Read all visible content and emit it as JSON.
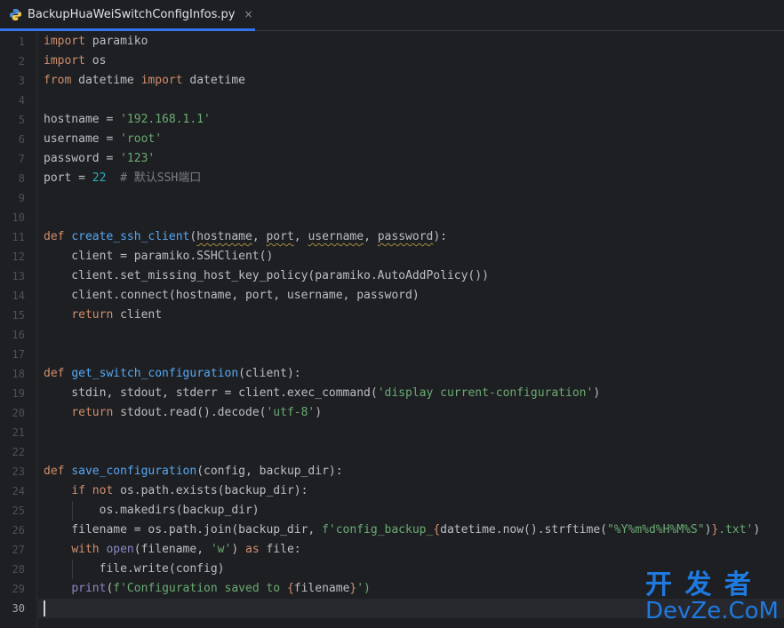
{
  "tab": {
    "filename": "BackupHuaWeiSwitchConfigInfos.py",
    "close": "×",
    "icon": "python-icon"
  },
  "editor": {
    "current_line": 30,
    "line_numbers": [
      "1",
      "2",
      "3",
      "4",
      "5",
      "6",
      "7",
      "8",
      "9",
      "10",
      "11",
      "12",
      "13",
      "14",
      "15",
      "16",
      "17",
      "18",
      "19",
      "20",
      "21",
      "22",
      "23",
      "24",
      "25",
      "26",
      "27",
      "28",
      "29",
      "30"
    ],
    "lines": [
      [
        {
          "t": "import",
          "c": "kw"
        },
        {
          "t": " paramiko"
        }
      ],
      [
        {
          "t": "import",
          "c": "kw"
        },
        {
          "t": " os"
        }
      ],
      [
        {
          "t": "from",
          "c": "kw"
        },
        {
          "t": " datetime "
        },
        {
          "t": "import",
          "c": "kw"
        },
        {
          "t": " datetime"
        }
      ],
      [],
      [
        {
          "t": "hostname = "
        },
        {
          "t": "'192.168.1.1'",
          "c": "str"
        }
      ],
      [
        {
          "t": "username = "
        },
        {
          "t": "'root'",
          "c": "str"
        }
      ],
      [
        {
          "t": "password = "
        },
        {
          "t": "'123'",
          "c": "str"
        }
      ],
      [
        {
          "t": "port = "
        },
        {
          "t": "22",
          "c": "num"
        },
        {
          "t": "  # 默认SSH端口",
          "c": "cmt"
        }
      ],
      [],
      [],
      [
        {
          "t": "def",
          "c": "kw"
        },
        {
          "t": " "
        },
        {
          "t": "create_ssh_client",
          "c": "fn"
        },
        {
          "t": "("
        },
        {
          "t": "hostname",
          "c": "squiggle"
        },
        {
          "t": ", "
        },
        {
          "t": "port",
          "c": "squiggle"
        },
        {
          "t": ", "
        },
        {
          "t": "username",
          "c": "squiggle"
        },
        {
          "t": ", "
        },
        {
          "t": "password",
          "c": "squiggle"
        },
        {
          "t": "):"
        }
      ],
      [
        {
          "t": "    client = paramiko.SSHClient()"
        }
      ],
      [
        {
          "t": "    client.set_missing_host_key_policy(paramiko.AutoAddPolicy())"
        }
      ],
      [
        {
          "t": "    client.connect(hostname, port, username, password)"
        }
      ],
      [
        {
          "t": "    "
        },
        {
          "t": "return",
          "c": "kw"
        },
        {
          "t": " client"
        }
      ],
      [],
      [],
      [
        {
          "t": "def",
          "c": "kw"
        },
        {
          "t": " "
        },
        {
          "t": "get_switch_configuration",
          "c": "fn"
        },
        {
          "t": "(client):"
        }
      ],
      [
        {
          "t": "    stdin, stdout, stderr = client.exec_command("
        },
        {
          "t": "'display current-configuration'",
          "c": "str"
        },
        {
          "t": ")"
        }
      ],
      [
        {
          "t": "    "
        },
        {
          "t": "return",
          "c": "kw"
        },
        {
          "t": " stdout.read().decode("
        },
        {
          "t": "'utf-8'",
          "c": "str"
        },
        {
          "t": ")"
        }
      ],
      [],
      [],
      [
        {
          "t": "def",
          "c": "kw"
        },
        {
          "t": " "
        },
        {
          "t": "save_configuration",
          "c": "fn"
        },
        {
          "t": "(config, backup_dir):"
        }
      ],
      [
        {
          "t": "    "
        },
        {
          "t": "if",
          "c": "kw"
        },
        {
          "t": " "
        },
        {
          "t": "not",
          "c": "kw"
        },
        {
          "t": " os.path.exists(backup_dir):"
        }
      ],
      [
        {
          "t": "        os.makedirs(backup_dir)"
        }
      ],
      [
        {
          "t": "    filename = os.path.join(backup_dir, "
        },
        {
          "t": "f'config_backup_",
          "c": "str"
        },
        {
          "t": "{",
          "c": "fmt"
        },
        {
          "t": "datetime.now().strftime("
        },
        {
          "t": "\"%Y%m%d%H%M%S\"",
          "c": "str"
        },
        {
          "t": ")"
        },
        {
          "t": "}",
          "c": "fmt"
        },
        {
          "t": ".txt'",
          "c": "str"
        },
        {
          "t": ")"
        }
      ],
      [
        {
          "t": "    "
        },
        {
          "t": "with",
          "c": "kw"
        },
        {
          "t": " "
        },
        {
          "t": "open",
          "c": "bi"
        },
        {
          "t": "(filename, "
        },
        {
          "t": "'w'",
          "c": "str"
        },
        {
          "t": ") "
        },
        {
          "t": "as",
          "c": "kw"
        },
        {
          "t": " file:"
        }
      ],
      [
        {
          "t": "        file.write(config)"
        }
      ],
      [
        {
          "t": "    "
        },
        {
          "t": "print",
          "c": "bi"
        },
        {
          "t": "("
        },
        {
          "t": "f'Configuration saved to ",
          "c": "str"
        },
        {
          "t": "{",
          "c": "fmt"
        },
        {
          "t": "filename"
        },
        {
          "t": "}",
          "c": "fmt"
        },
        {
          "t": "')",
          "c": "str"
        }
      ],
      []
    ]
  },
  "watermark": {
    "top": "开 发 者",
    "bottom": "DevZe.CoM"
  }
}
